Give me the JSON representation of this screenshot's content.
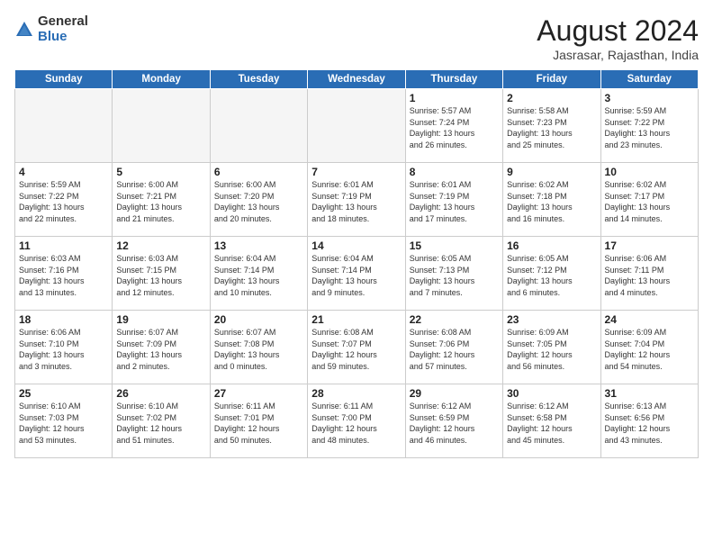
{
  "header": {
    "logo_general": "General",
    "logo_blue": "Blue",
    "month_title": "August 2024",
    "location": "Jasrasar, Rajasthan, India"
  },
  "weekdays": [
    "Sunday",
    "Monday",
    "Tuesday",
    "Wednesday",
    "Thursday",
    "Friday",
    "Saturday"
  ],
  "weeks": [
    [
      {
        "day": "",
        "info": ""
      },
      {
        "day": "",
        "info": ""
      },
      {
        "day": "",
        "info": ""
      },
      {
        "day": "",
        "info": ""
      },
      {
        "day": "1",
        "info": "Sunrise: 5:57 AM\nSunset: 7:24 PM\nDaylight: 13 hours\nand 26 minutes."
      },
      {
        "day": "2",
        "info": "Sunrise: 5:58 AM\nSunset: 7:23 PM\nDaylight: 13 hours\nand 25 minutes."
      },
      {
        "day": "3",
        "info": "Sunrise: 5:59 AM\nSunset: 7:22 PM\nDaylight: 13 hours\nand 23 minutes."
      }
    ],
    [
      {
        "day": "4",
        "info": "Sunrise: 5:59 AM\nSunset: 7:22 PM\nDaylight: 13 hours\nand 22 minutes."
      },
      {
        "day": "5",
        "info": "Sunrise: 6:00 AM\nSunset: 7:21 PM\nDaylight: 13 hours\nand 21 minutes."
      },
      {
        "day": "6",
        "info": "Sunrise: 6:00 AM\nSunset: 7:20 PM\nDaylight: 13 hours\nand 20 minutes."
      },
      {
        "day": "7",
        "info": "Sunrise: 6:01 AM\nSunset: 7:19 PM\nDaylight: 13 hours\nand 18 minutes."
      },
      {
        "day": "8",
        "info": "Sunrise: 6:01 AM\nSunset: 7:19 PM\nDaylight: 13 hours\nand 17 minutes."
      },
      {
        "day": "9",
        "info": "Sunrise: 6:02 AM\nSunset: 7:18 PM\nDaylight: 13 hours\nand 16 minutes."
      },
      {
        "day": "10",
        "info": "Sunrise: 6:02 AM\nSunset: 7:17 PM\nDaylight: 13 hours\nand 14 minutes."
      }
    ],
    [
      {
        "day": "11",
        "info": "Sunrise: 6:03 AM\nSunset: 7:16 PM\nDaylight: 13 hours\nand 13 minutes."
      },
      {
        "day": "12",
        "info": "Sunrise: 6:03 AM\nSunset: 7:15 PM\nDaylight: 13 hours\nand 12 minutes."
      },
      {
        "day": "13",
        "info": "Sunrise: 6:04 AM\nSunset: 7:14 PM\nDaylight: 13 hours\nand 10 minutes."
      },
      {
        "day": "14",
        "info": "Sunrise: 6:04 AM\nSunset: 7:14 PM\nDaylight: 13 hours\nand 9 minutes."
      },
      {
        "day": "15",
        "info": "Sunrise: 6:05 AM\nSunset: 7:13 PM\nDaylight: 13 hours\nand 7 minutes."
      },
      {
        "day": "16",
        "info": "Sunrise: 6:05 AM\nSunset: 7:12 PM\nDaylight: 13 hours\nand 6 minutes."
      },
      {
        "day": "17",
        "info": "Sunrise: 6:06 AM\nSunset: 7:11 PM\nDaylight: 13 hours\nand 4 minutes."
      }
    ],
    [
      {
        "day": "18",
        "info": "Sunrise: 6:06 AM\nSunset: 7:10 PM\nDaylight: 13 hours\nand 3 minutes."
      },
      {
        "day": "19",
        "info": "Sunrise: 6:07 AM\nSunset: 7:09 PM\nDaylight: 13 hours\nand 2 minutes."
      },
      {
        "day": "20",
        "info": "Sunrise: 6:07 AM\nSunset: 7:08 PM\nDaylight: 13 hours\nand 0 minutes."
      },
      {
        "day": "21",
        "info": "Sunrise: 6:08 AM\nSunset: 7:07 PM\nDaylight: 12 hours\nand 59 minutes."
      },
      {
        "day": "22",
        "info": "Sunrise: 6:08 AM\nSunset: 7:06 PM\nDaylight: 12 hours\nand 57 minutes."
      },
      {
        "day": "23",
        "info": "Sunrise: 6:09 AM\nSunset: 7:05 PM\nDaylight: 12 hours\nand 56 minutes."
      },
      {
        "day": "24",
        "info": "Sunrise: 6:09 AM\nSunset: 7:04 PM\nDaylight: 12 hours\nand 54 minutes."
      }
    ],
    [
      {
        "day": "25",
        "info": "Sunrise: 6:10 AM\nSunset: 7:03 PM\nDaylight: 12 hours\nand 53 minutes."
      },
      {
        "day": "26",
        "info": "Sunrise: 6:10 AM\nSunset: 7:02 PM\nDaylight: 12 hours\nand 51 minutes."
      },
      {
        "day": "27",
        "info": "Sunrise: 6:11 AM\nSunset: 7:01 PM\nDaylight: 12 hours\nand 50 minutes."
      },
      {
        "day": "28",
        "info": "Sunrise: 6:11 AM\nSunset: 7:00 PM\nDaylight: 12 hours\nand 48 minutes."
      },
      {
        "day": "29",
        "info": "Sunrise: 6:12 AM\nSunset: 6:59 PM\nDaylight: 12 hours\nand 46 minutes."
      },
      {
        "day": "30",
        "info": "Sunrise: 6:12 AM\nSunset: 6:58 PM\nDaylight: 12 hours\nand 45 minutes."
      },
      {
        "day": "31",
        "info": "Sunrise: 6:13 AM\nSunset: 6:56 PM\nDaylight: 12 hours\nand 43 minutes."
      }
    ]
  ]
}
